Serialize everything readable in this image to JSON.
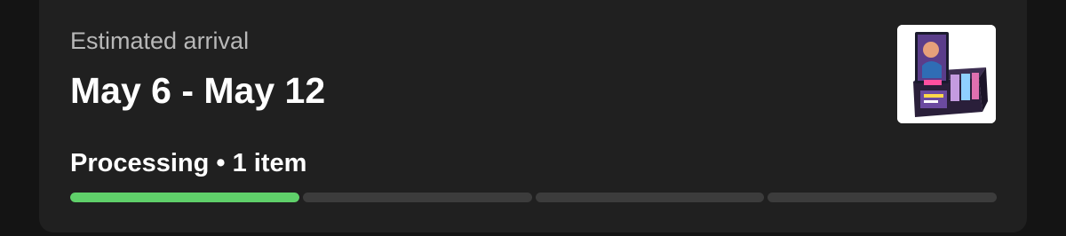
{
  "order_card": {
    "arrival_label": "Estimated arrival",
    "arrival_range": "May 6 - May 12",
    "status": "Processing • 1 item",
    "progress": {
      "segments_total": 4,
      "completed_fraction": 0.25,
      "fill_color": "#5fd06a",
      "track_color": "#3c3c3c"
    },
    "product_thumbnail": {
      "icon": "trading-card-box-image"
    }
  }
}
